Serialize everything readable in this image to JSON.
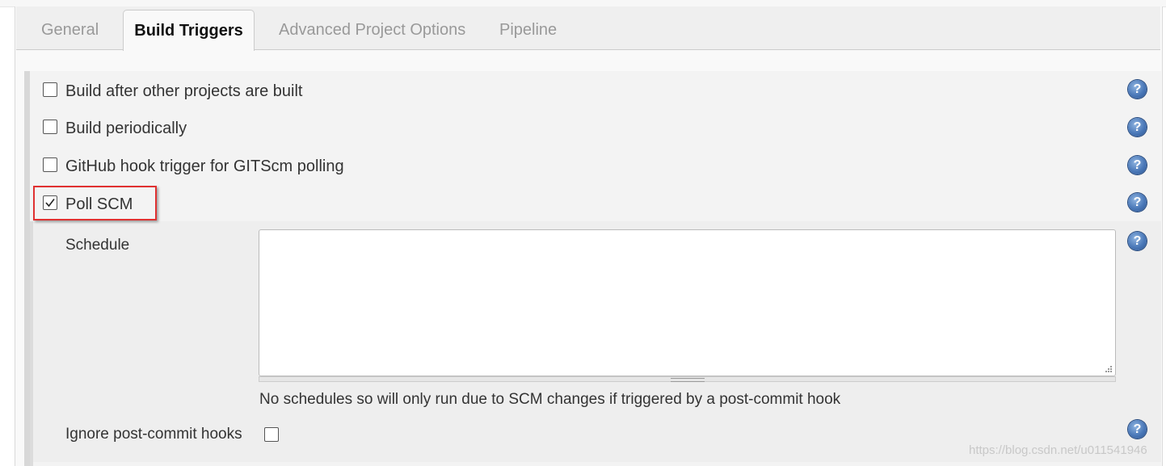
{
  "tabs": [
    {
      "label": "General",
      "active": false
    },
    {
      "label": "Build Triggers",
      "active": true
    },
    {
      "label": "Advanced Project Options",
      "active": false
    },
    {
      "label": "Pipeline",
      "active": false
    }
  ],
  "triggers": [
    {
      "label": "Build after other projects are built",
      "checked": false
    },
    {
      "label": "Build periodically",
      "checked": false
    },
    {
      "label": "GitHub hook trigger for GITScm polling",
      "checked": false
    },
    {
      "label": "Poll SCM",
      "checked": true
    }
  ],
  "poll_scm": {
    "schedule_label": "Schedule",
    "schedule_value": "",
    "schedule_description": "No schedules so will only run due to SCM changes if triggered by a post-commit hook",
    "ignore_label": "Ignore post-commit hooks",
    "ignore_checked": false
  },
  "help_icon_glyph": "?",
  "watermark": "https://blog.csdn.net/u011541946",
  "colors": {
    "highlight_box": "#e03131",
    "help_icon": "#4a78b8",
    "active_tab_text": "#111111",
    "inactive_tab_text": "#999999"
  }
}
